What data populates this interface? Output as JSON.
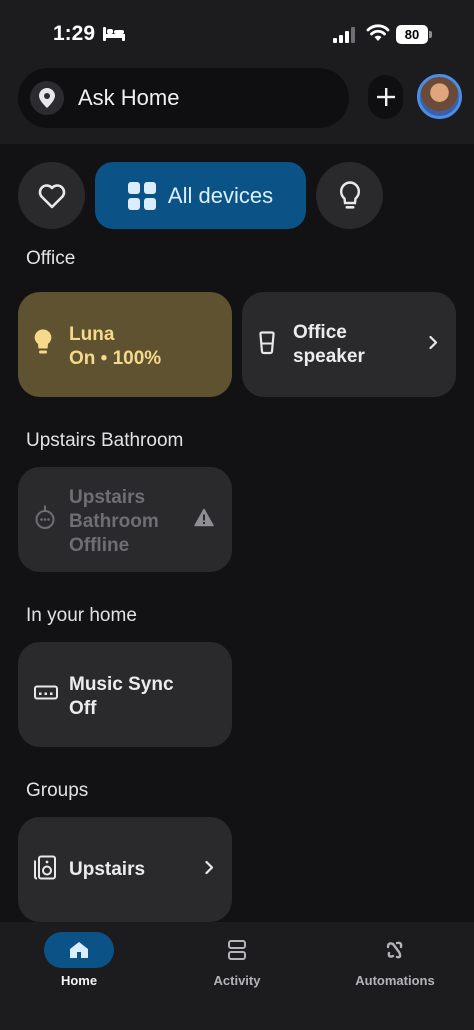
{
  "status_bar": {
    "time": "1:29",
    "battery": "80"
  },
  "header": {
    "search_label": "Ask Home"
  },
  "filters": {
    "all_devices_label": "All devices"
  },
  "sections": {
    "office": {
      "title": "Office",
      "tiles": [
        {
          "name": "Luna",
          "state": "On • 100%"
        },
        {
          "name_line1": "Office",
          "name_line2": "speaker"
        }
      ]
    },
    "upstairs_bathroom": {
      "title": "Upstairs Bathroom",
      "tile": {
        "line1": "Upstairs",
        "line2": "Bathroom",
        "line3": "Offline"
      }
    },
    "in_your_home": {
      "title": "In your home",
      "tile": {
        "name": "Music Sync",
        "state": "Off"
      }
    },
    "groups": {
      "title": "Groups",
      "tile": {
        "name": "Upstairs"
      }
    }
  },
  "nav": {
    "items": [
      {
        "label": "Home",
        "active": true
      },
      {
        "label": "Activity",
        "active": false
      },
      {
        "label": "Automations",
        "active": false
      }
    ]
  },
  "colors": {
    "accent": "#0b5387",
    "light_on": "#5e5230",
    "light_text": "#f6d98a"
  }
}
